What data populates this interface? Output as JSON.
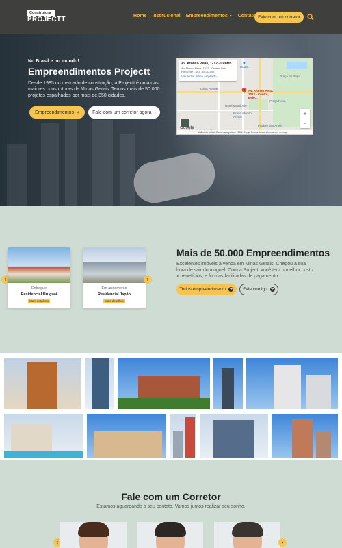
{
  "nav": {
    "logo_small": "Construtora",
    "logo_big": "PROJECTT",
    "menu": [
      {
        "label": "Home"
      },
      {
        "label": "Institucional"
      },
      {
        "label": "Empreendimentos"
      },
      {
        "label": "Contatos"
      }
    ],
    "cta": "Fale com um corretor",
    "search_icon": "search-icon"
  },
  "hero": {
    "kicker": "No Brasil e no mundo!",
    "title": "Empreendimentos Projectt",
    "text": "Desde 1985 no mercado de construção, a Projectt é uma das maiores construtoras de Minas Gerais. Temos mais de 50.000 projetos espalhados por mais de 350 cidades.",
    "btn_primary": "Empreendimentos",
    "btn_secondary": "Fale com um corretor agora"
  },
  "map": {
    "info_title": "Av. Afonso Pena, 1212 - Centro",
    "info_address": "Av. Afonso Pena, 1212 - Centro, Belo Horizonte - MG, 30130-002",
    "info_link": "Visualizar mapa ampliado",
    "directions": "Rotas",
    "labels": {
      "lojas": "Lojas Renner",
      "pin_label": "Av. Afonso Pena, 1212 - Centro, Belo...",
      "praca": "Praça do Papa",
      "hotel": "Hotel Metrópole",
      "afonso": "Praça Afonso Arinos",
      "condominio": "Condomínio do Edifício",
      "praca_nova": "Praça Nova",
      "palacio": "Palácio das Artes"
    },
    "google": "Google",
    "footer": "Atalhos do teclado   Dados cartográficos ©2022 Google   Termos de uso   Informar erro no mapa"
  },
  "section2": {
    "cards": [
      {
        "status": "Entregue",
        "name": "Residencial Uruguai",
        "details": "Mais detalhes"
      },
      {
        "status": "Em andamento",
        "name": "Residencial Japão",
        "details": "Mais detalhes"
      }
    ],
    "title": "Mais de 50.000 Empreendimentos",
    "text": "Excelentes imóveis à venda em Minas Gerais! Chegou a sua hora de sair do aluguel. Com a Projectt você tem o melhor custo x benefícios, e formas facilitadas de pagamento.",
    "btn_primary": "Todos empreendimento",
    "btn_secondary": "Fale comigo"
  },
  "section4": {
    "title": "Fale com um Corretor",
    "subtitle": "Estamos aguardando o seu contato. Vamos juntos realizar seu sonho."
  },
  "colors": {
    "accent": "#f6c453",
    "nav_bg": "#3f3f3d",
    "section_bg": "#cfdcd3"
  }
}
